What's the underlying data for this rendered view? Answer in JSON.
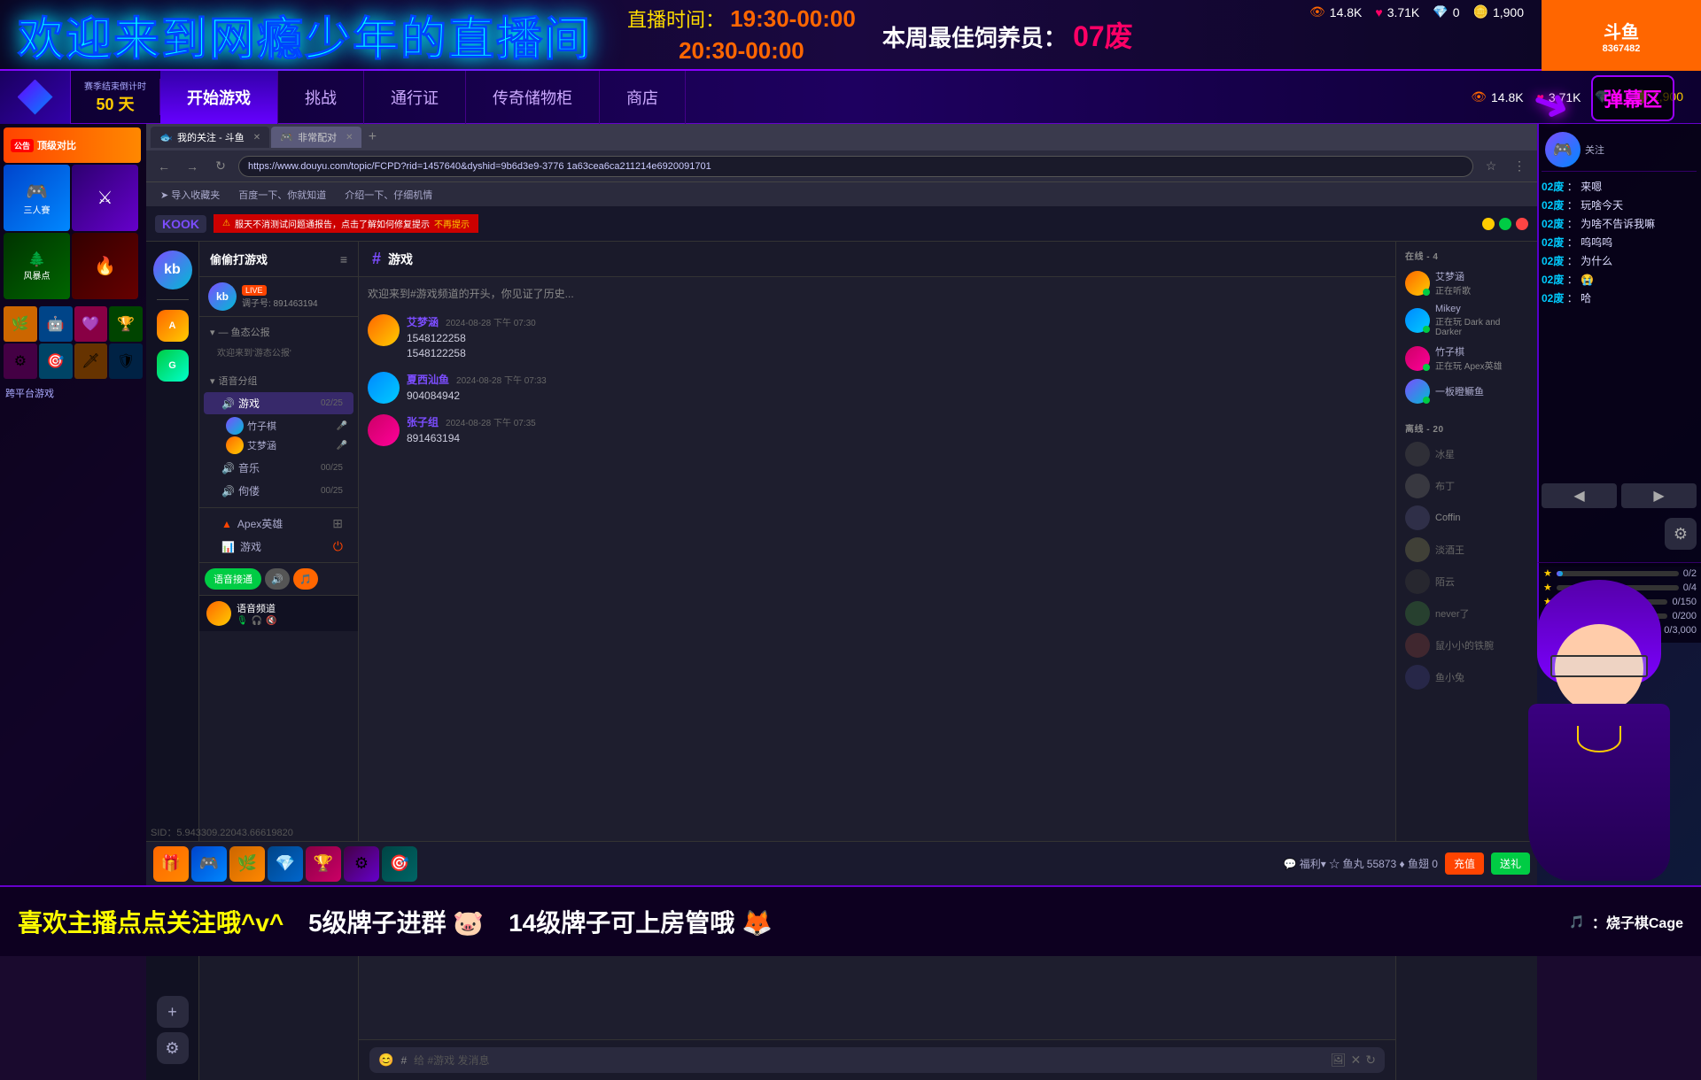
{
  "page": {
    "title": "欢迎来到网瘾少年的直播间",
    "stream_time_label": "直播时间：",
    "stream_time1": "19:30-00:00",
    "stream_time2": "20:30-00:00",
    "best_feeder_label": "本周最佳饲养员：",
    "best_feeder": "07废",
    "streamer_id": "8367482",
    "season_label": "赛季结束倒计时",
    "season_days": "50 天"
  },
  "stats": {
    "views": "14.8K",
    "likes": "3.71K",
    "diamonds": "0",
    "coins": "1,900"
  },
  "nav": {
    "items": [
      {
        "label": "开始游戏",
        "active": true
      },
      {
        "label": "挑战",
        "active": false
      },
      {
        "label": "通行证",
        "active": false
      },
      {
        "label": "传奇储物柜",
        "active": false
      },
      {
        "label": "商店",
        "active": false
      }
    ]
  },
  "browser": {
    "tabs": [
      {
        "label": "我的关注 - 斗鱼",
        "active": true
      },
      {
        "label": "非常配对",
        "active": false
      }
    ],
    "url": "https://www.douyu.com/topic/FCPD?rid=1457640&dyshid=9b6d3e9-3776 1a63cea6ca211214e6920091701"
  },
  "kook": {
    "logo": "KOOK",
    "notification": "服天不消测试问题通报告，点击了解如何修复提示",
    "server_name": "偷偷打游戏",
    "channel_hash": "#",
    "channel_name": "游戏",
    "welcome_text": "欢迎来到#游戏频道的开头，你见证了历史...",
    "user_code": "kb",
    "user_tag": "LIVE",
    "user_id_label": "调子号: 891463194",
    "groups": {
      "label": "— 鱼态公报",
      "sub_label": "欢迎来到'游态公报'"
    },
    "voice_groups": {
      "label": "语音分组",
      "channels": [
        {
          "name": "游戏",
          "count": "02/25"
        },
        {
          "name": "竹子棋",
          "icon": true
        },
        {
          "name": "艾梦涵",
          "icon": true
        },
        {
          "name": "音乐",
          "count": "00/25"
        },
        {
          "name": "佝偻",
          "count": "00/25"
        }
      ]
    },
    "apps": [
      {
        "name": "Apex英雄",
        "icon": "▲"
      },
      {
        "name": "游戏",
        "icon": "📊"
      }
    ],
    "messages": [
      {
        "username": "艾梦涵",
        "time": "2024-08-28 下午 07:30",
        "text1": "1548122258",
        "text2": "1548122258"
      },
      {
        "username": "夏西汕鱼",
        "time": "2024-08-28 下午 07:33",
        "text1": "904084942"
      },
      {
        "username": "张子组",
        "time": "2024-08-28 下午 07:35",
        "text1": "891463194"
      }
    ],
    "input_placeholder": "给 #游戏 发消息"
  },
  "member_list": {
    "online_label": "在线 - 4",
    "offline_label": "离线 - 20",
    "online_members": [
      {
        "name": "艾梦涵",
        "status": "正在听歌"
      },
      {
        "name": "Mikey",
        "status": "正在玩 Dark and Darker"
      },
      {
        "name": "竹子棋",
        "status": "正在玩 Apex英雄"
      },
      {
        "name": "一板瞪鳜鱼",
        "status": ""
      }
    ],
    "offline_members": [
      {
        "name": "冰星"
      },
      {
        "name": "布丁"
      },
      {
        "name": "Coffin"
      },
      {
        "name": "淡酒王"
      },
      {
        "name": "陌云"
      },
      {
        "name": "never了"
      },
      {
        "name": "鼠小小的铁腕"
      },
      {
        "name": "鱼小兔"
      }
    ]
  },
  "right_chat": {
    "messages": [
      {
        "username": "02废",
        "text": "来嗯"
      },
      {
        "username": "02废",
        "text": "玩啥今天"
      },
      {
        "username": "02废",
        "text": "为啥不告诉我嘛"
      },
      {
        "username": "02废",
        "text": "呜呜呜"
      },
      {
        "username": "02废",
        "text": "为什么"
      },
      {
        "username": "02废",
        "text": "😭"
      },
      {
        "username": "02废",
        "text": "哈"
      }
    ]
  },
  "stars_panel": {
    "items": [
      {
        "label": "0/2",
        "fill": 5
      },
      {
        "label": "0/4",
        "fill": 0
      },
      {
        "label": "0/150",
        "fill": 0
      },
      {
        "label": "0/200",
        "fill": 0
      },
      {
        "label": "0/3,000",
        "fill": 0
      }
    ]
  },
  "bottom_bar": {
    "text1": "喜欢主播点点关注哦^v^",
    "text2": "5级牌子进群",
    "text3": "🐷",
    "text4": "14级牌子可上房管哦",
    "text5": "🦊",
    "tiktok_label": "🎵",
    "creator_name": "：烧子棋Cage"
  },
  "interaction_zone": {
    "label": "弹幕区"
  },
  "sid": "SID：5.943309.22043.66619820"
}
